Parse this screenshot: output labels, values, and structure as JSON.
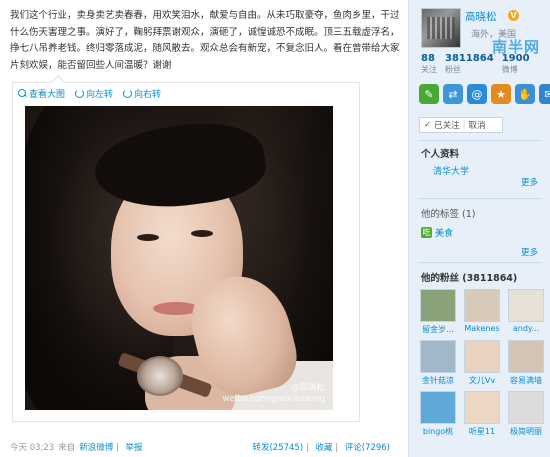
{
  "post": {
    "text": "我们这个行业，卖身卖艺卖春春，用欢笑泪水，献爱与自由。从未巧取豪夺，鱼肉乡里，干过什么伤天害理之事。演好了，鞠躬拜票谢观众，演砸了，诚惶诚恐不成眠。顶三五载虚浮名，挣七八吊养老钱。终归零落成泥，随风散去。观众总会有新宠，不复念旧人。看在曾带给大家片刻欢娱，能否留回些人间温暖？谢谢",
    "toolbar": {
      "zoom_label": "查看大图",
      "rotate_left_label": "向左转",
      "rotate_right_label": "向右转"
    },
    "watermark": "@高晓松\nweibo.com/gaoxiaosong",
    "footer": {
      "time": "今天 03:23",
      "source_prefix": "来自",
      "source": "新浪微博",
      "report": "举报",
      "repost": "转发(25745)",
      "favorite": "收藏",
      "comment": "评论(7296)"
    }
  },
  "sidebar": {
    "username": "高晓松",
    "verified": "V",
    "location": "海外，美国",
    "brand": "南半网",
    "stats": [
      {
        "num": "88",
        "label": "关注"
      },
      {
        "num": "3811864",
        "label": "粉丝"
      },
      {
        "num": "1900",
        "label": "微博"
      }
    ],
    "app_icons": [
      {
        "name": "sina-app-icon",
        "glyph": "✎",
        "color": "#47a833"
      },
      {
        "name": "share-app-icon",
        "glyph": "⇄",
        "color": "#3e96d6"
      },
      {
        "name": "at-app-icon",
        "glyph": "@",
        "color": "#2a8ad8"
      },
      {
        "name": "game-app-icon",
        "glyph": "★",
        "color": "#e58a1e"
      },
      {
        "name": "hand-app-icon",
        "glyph": "✋",
        "color": "#3b8fd4"
      },
      {
        "name": "chat-app-icon",
        "glyph": "✉",
        "color": "#2f86cf"
      }
    ],
    "follow_status": "已关注",
    "follow_cancel": "取消",
    "profile_title": "个人资料",
    "school": "清华大学",
    "more": "更多",
    "tags_title": "他的标签 (1)",
    "tag": "美食",
    "fans_title": "他的粉丝 (3811864)",
    "fans": [
      {
        "name": "留金岁...",
        "bg": "#8aa27a"
      },
      {
        "name": "Makenes",
        "bg": "#d9c9b8"
      },
      {
        "name": "andy...",
        "bg": "#e6e0d6"
      },
      {
        "name": "金针菇凉",
        "bg": "#a2b8c8"
      },
      {
        "name": "文儿Vv",
        "bg": "#e9d3c0"
      },
      {
        "name": "容易满墙",
        "bg": "#d3c4b6"
      },
      {
        "name": "bingo桃",
        "bg": "#5fa9d9"
      },
      {
        "name": "听星11",
        "bg": "#ecd7c4"
      },
      {
        "name": "极简明丽",
        "bg": "#dcdcdc"
      }
    ]
  }
}
